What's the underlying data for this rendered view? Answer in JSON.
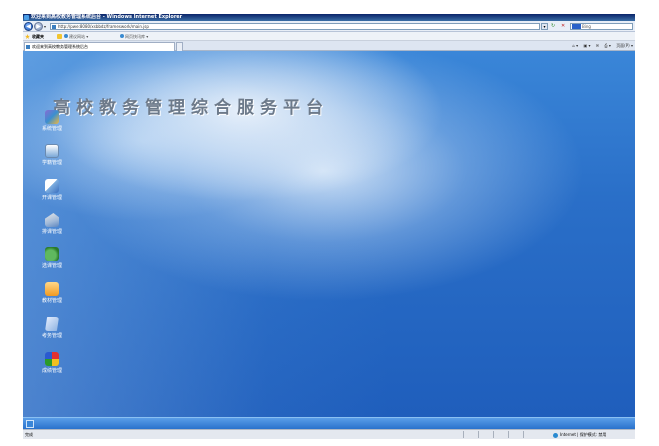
{
  "window": {
    "title": "欢迎来到高校教务管理系统后台 - Windows Internet Explorer"
  },
  "address_bar": {
    "url": "http://pwe:8080/xsbbdz/frameswork/main.jsp",
    "search_placeholder": "Bing"
  },
  "favorites_bar": {
    "label": "收藏夹",
    "links": [
      "建议网站 ▾",
      "网页快讯库 ▾"
    ]
  },
  "tab": {
    "title": "欢迎来到高校教务管理系统后台"
  },
  "command_bar": {
    "page_label": "页面(P) ▾"
  },
  "page": {
    "banner": "高校教务管理综合服务平台",
    "menu": [
      {
        "label": "系统管理",
        "icon": "system-icon"
      },
      {
        "label": "学籍管理",
        "icon": "student-icon"
      },
      {
        "label": "开课管理",
        "icon": "course-icon"
      },
      {
        "label": "排课管理",
        "icon": "schedule-icon"
      },
      {
        "label": "选课管理",
        "icon": "retake-icon"
      },
      {
        "label": "教材管理",
        "icon": "textbook-icon"
      },
      {
        "label": "考务管理",
        "icon": "exam-icon"
      },
      {
        "label": "成绩管理",
        "icon": "grade-icon"
      }
    ]
  },
  "status_bar": {
    "text": "完成",
    "zone": "Internet | 保护模式: 禁用"
  }
}
